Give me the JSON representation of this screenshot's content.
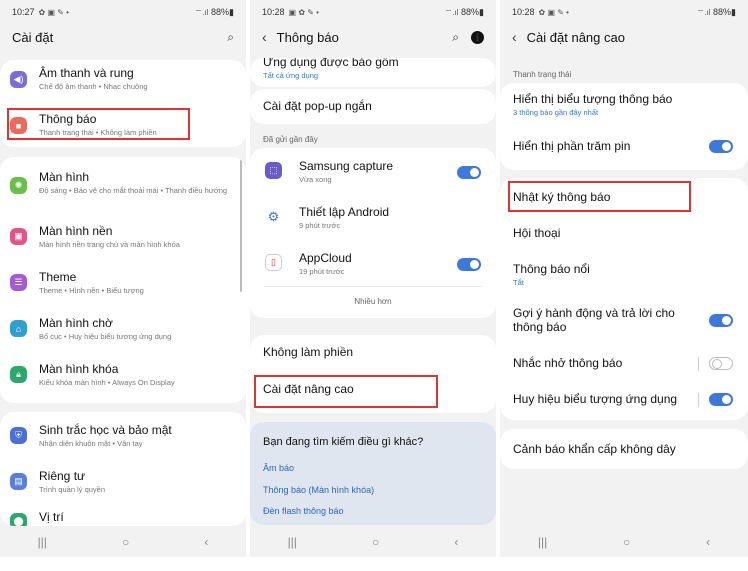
{
  "status": {
    "p1_time": "10:27",
    "p2_time": "10:28",
    "p3_time": "10:28",
    "battery": "88%"
  },
  "p1": {
    "title": "Cài đặt",
    "items": [
      {
        "label": "Âm thanh và rung",
        "sub": "Chế độ âm thanh • Nhạc chuông"
      },
      {
        "label": "Thông báo",
        "sub": "Thanh trạng thái • Không làm phiền"
      },
      {
        "label": "Màn hình",
        "sub": "Độ sáng • Bảo vệ cho mắt thoải mái • Thanh điều hướng"
      },
      {
        "label": "Màn hình nền",
        "sub": "Màn hình nền trang chủ và màn hình khóa"
      },
      {
        "label": "Theme",
        "sub": "Theme • Hình nền • Biểu tượng"
      },
      {
        "label": "Màn hình chờ",
        "sub": "Bố cục • Huy hiệu biểu tượng ứng dụng"
      },
      {
        "label": "Màn hình khóa",
        "sub": "Kiểu khóa màn hình • Always On Display"
      },
      {
        "label": "Sinh trắc học và bảo mật",
        "sub": "Nhận diện khuôn mặt • Vân tay"
      },
      {
        "label": "Riêng tư",
        "sub": "Trình quản lý quyền"
      },
      {
        "label": "Vị trí",
        "sub": ""
      }
    ]
  },
  "p2": {
    "title": "Thông báo",
    "partial_label": "Ứng dụng được báo gồm",
    "partial_sub": "Tất cả ứng dụng",
    "popup": "Cài đặt pop-up ngắn",
    "recent_label": "Đã gửi gần đây",
    "apps": [
      {
        "label": "Samsung capture",
        "sub": "Vừa xong"
      },
      {
        "label": "Thiết lập Android",
        "sub": "9 phút trước"
      },
      {
        "label": "AppCloud",
        "sub": "19 phút trước"
      }
    ],
    "more": "Nhiều hơn",
    "dnd": "Không làm phiền",
    "advanced": "Cài đặt nâng cao",
    "search_q": "Bạn đang tìm kiếm điều gì khác?",
    "links": [
      "Âm báo",
      "Thông báo (Màn hình khóa)",
      "Đèn flash thông báo"
    ]
  },
  "p3": {
    "title": "Cài đặt nâng cao",
    "section": "Thanh trạng thái",
    "show_icons": "Hiển thị biểu tượng thông báo",
    "show_icons_sub": "3 thông báo gần đây nhất",
    "battery_pct": "Hiển thị phần trăm pin",
    "history": "Nhật ký thông báo",
    "conversations": "Hội thoại",
    "floating": "Thông báo nổi",
    "floating_sub": "Tắt",
    "suggest": "Gợi ý hành động và trả lời cho thông báo",
    "reminders": "Nhắc nhở thông báo",
    "badges": "Huy hiệu biểu tượng ứng dụng",
    "wireless": "Cảnh báo khẩn cấp không dây"
  },
  "nav": {
    "recents": "|||",
    "home": "○",
    "back": "‹"
  },
  "colors": {
    "toggle_on": "#3d79d9",
    "highlight": "#e03333",
    "link": "#2a66c0"
  }
}
